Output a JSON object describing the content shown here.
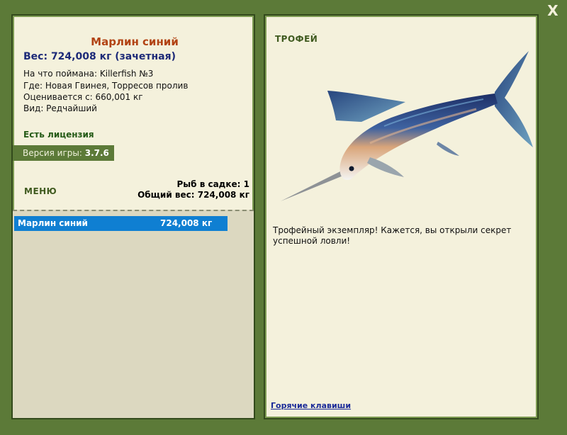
{
  "window": {
    "close_label": "X"
  },
  "fish": {
    "name": "Марлин синий",
    "weight_line": "Вес: 724,008 кг (зачетная)",
    "caught_on": "На что поймана: Killerfish №3",
    "location": "Где: Новая Гвинея, Торресов пролив",
    "value": "Оценивается с: 660,001 кг",
    "rarity": "Вид: Редчайший"
  },
  "license": "Есть лицензия",
  "version": {
    "label": "Версия игры: ",
    "value": "3.7.6"
  },
  "menu_label": "МЕНЮ",
  "stats": {
    "count": "Рыб в садке: 1",
    "total_weight": "Общий вес: 724,008 кг"
  },
  "fish_list": [
    {
      "name": "Марлин синий",
      "weight": "724,008 кг"
    }
  ],
  "trophy": {
    "label": "ТРОФЕЙ",
    "description": "Трофейный экземпляр! Кажется, вы открыли секрет успешной ловли!"
  },
  "hotkeys_link": "Горячие клавиши",
  "colors": {
    "background": "#5c7a38",
    "panel": "#f4f1dc",
    "title": "#b24314",
    "weight": "#1d2a78",
    "selection": "#0f7fd2",
    "link": "#1a2a98"
  }
}
